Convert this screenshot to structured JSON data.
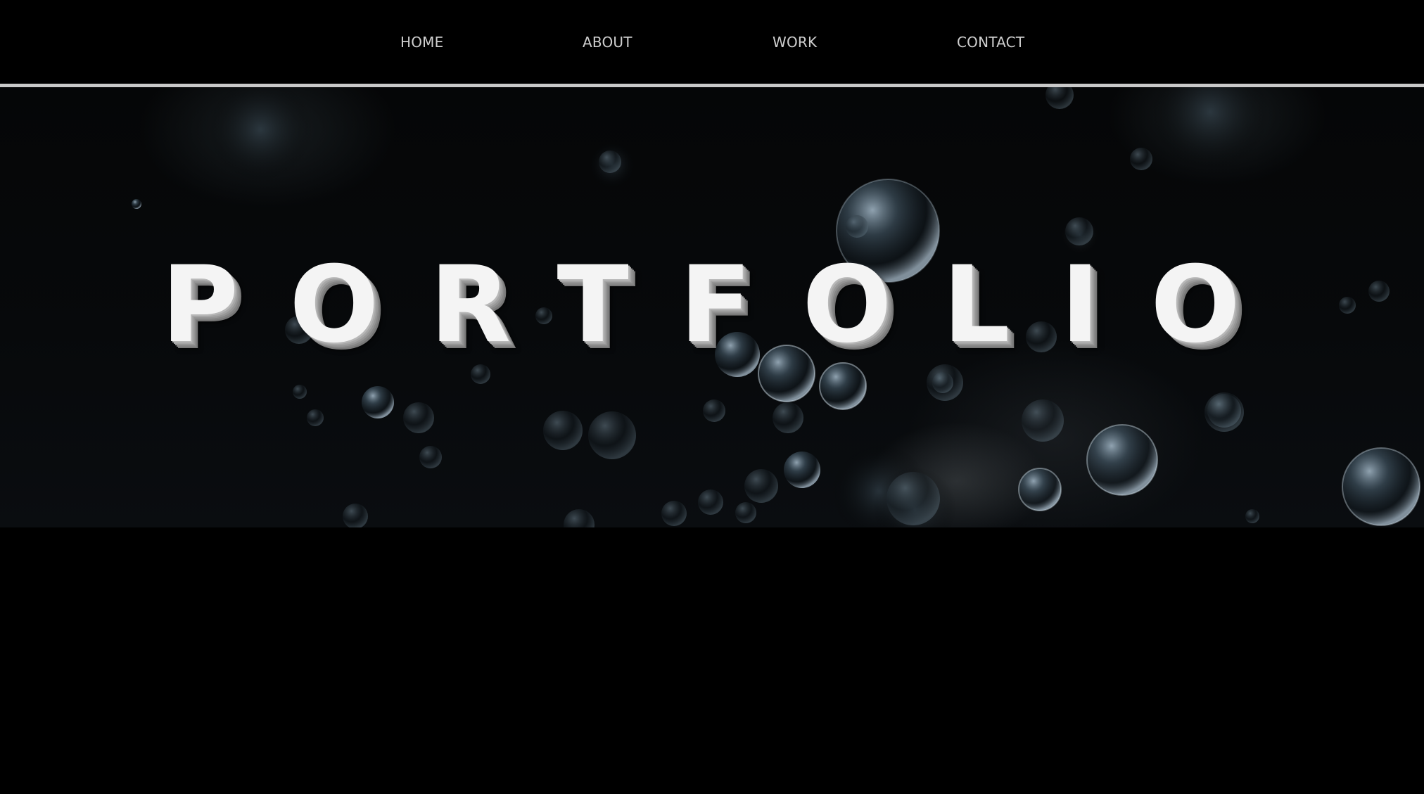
{
  "nav": {
    "items": [
      {
        "label": "HOME"
      },
      {
        "label": "ABOUT"
      },
      {
        "label": "WORK"
      },
      {
        "label": "CONTACT"
      }
    ]
  },
  "hero": {
    "title": "PORTFOLIO"
  },
  "colors": {
    "background": "#000000",
    "nav_text": "#cfcfcf",
    "divider": "#c9c9c9",
    "title": "#f4f4f4"
  }
}
